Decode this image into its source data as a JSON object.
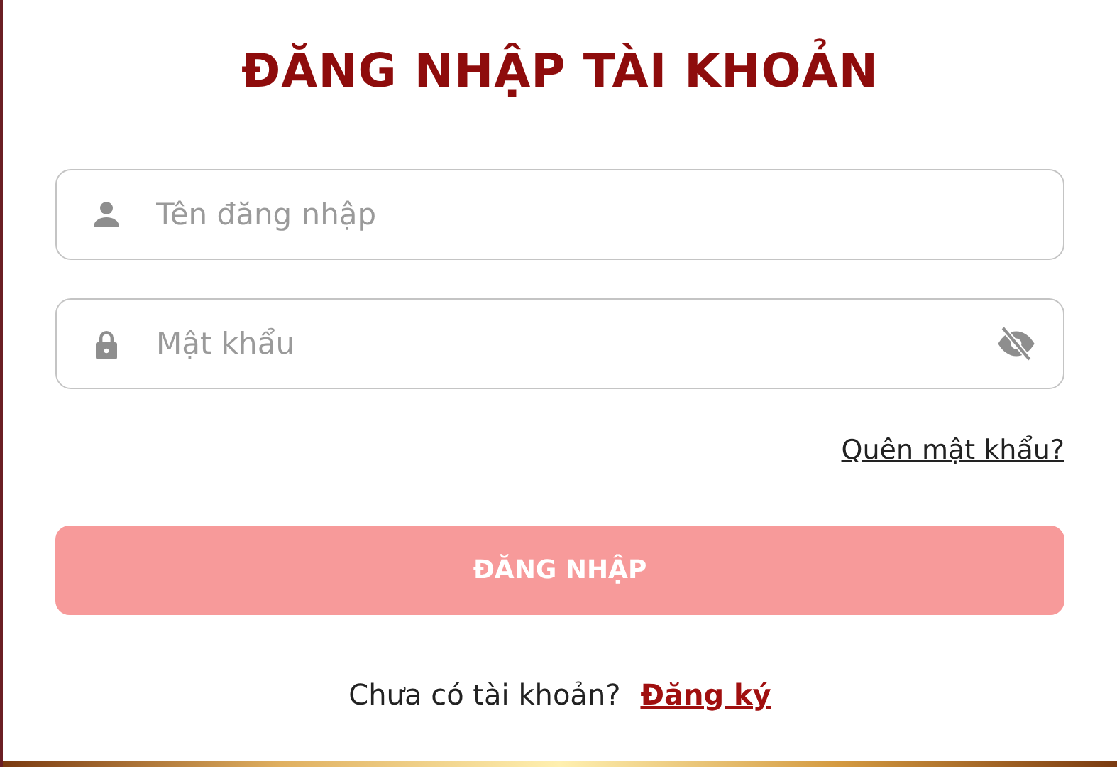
{
  "title": "ĐĂNG NHẬP TÀI KHOẢN",
  "username": {
    "placeholder": "Tên đăng nhập"
  },
  "password": {
    "placeholder": "Mật khẩu",
    "visible": false
  },
  "forgot_link": "Quên mật khẩu?",
  "submit": {
    "label": "ĐĂNG NHẬP",
    "disabled": true
  },
  "signup": {
    "prompt": "Chưa có tài khoản?",
    "link": "Đăng ký"
  }
}
